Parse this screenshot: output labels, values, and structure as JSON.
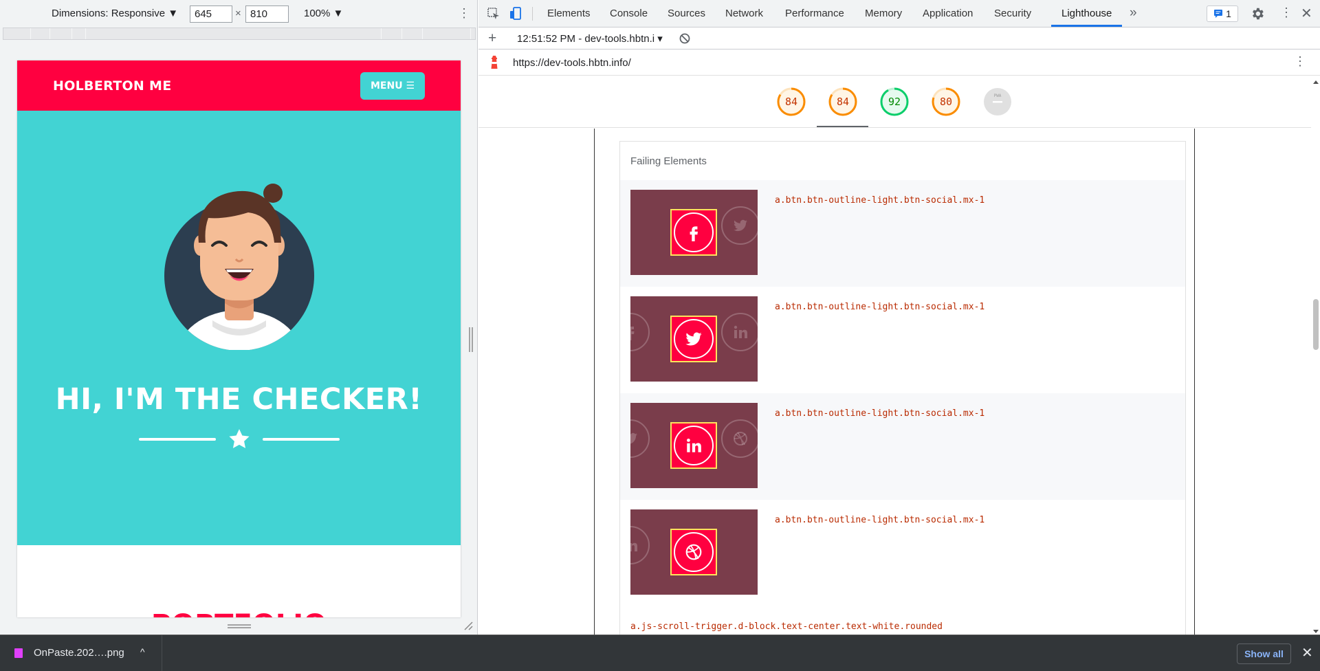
{
  "device_toolbar": {
    "dimensions_label": "Dimensions: Responsive ▼",
    "width": "645",
    "times": "×",
    "height": "810",
    "zoom": "100% ▼",
    "more": "⋮"
  },
  "site": {
    "brand": "HOLBERTON ME",
    "menu_label": "MENU ☰",
    "hero_title": "HI, I'M THE CHECKER!",
    "next_section_heading": "PORTFOLIO"
  },
  "devtools": {
    "tabs": [
      "Elements",
      "Console",
      "Sources",
      "Network",
      "Performance",
      "Memory",
      "Application",
      "Security",
      "Lighthouse"
    ],
    "more_tabs": "»",
    "issues_count": "1",
    "kebab": "⋮",
    "close": "✕"
  },
  "lighthouse": {
    "add": "+",
    "report_label": "12:51:52 PM - dev-tools.hbtn.i ▾",
    "url": "https://dev-tools.hbtn.info/",
    "kebab": "⋮",
    "scores": [
      {
        "value": "84",
        "fraction": 0.84,
        "status": "average"
      },
      {
        "value": "84",
        "fraction": 0.84,
        "status": "average"
      },
      {
        "value": "92",
        "fraction": 0.92,
        "status": "pass"
      },
      {
        "value": "80",
        "fraction": 0.8,
        "status": "average"
      },
      {
        "value": "PWA",
        "fraction": 0,
        "status": "na"
      }
    ],
    "failing_header": "Failing Elements",
    "failing_rows": [
      {
        "selector": "a.btn.btn-outline-light.btn-social.mx-1",
        "icon": "facebook-icon"
      },
      {
        "selector": "a.btn.btn-outline-light.btn-social.mx-1",
        "icon": "twitter-icon"
      },
      {
        "selector": "a.btn.btn-outline-light.btn-social.mx-1",
        "icon": "linkedin-icon"
      },
      {
        "selector": "a.btn.btn-outline-light.btn-social.mx-1",
        "icon": "dribbble-icon"
      }
    ],
    "last_selector": "a.js-scroll-trigger.d-block.text-center.text-white.rounded"
  },
  "download_bar": {
    "file_name": "OnPaste.202….png",
    "caret": "^",
    "show_all": "Show all",
    "close": "✕"
  },
  "colors": {
    "brand_red": "#ff0040",
    "teal": "#42d3d3",
    "gauge_orange": "#fa8c00",
    "gauge_green": "#0cce6b",
    "devtools_blue": "#1a73e8"
  }
}
